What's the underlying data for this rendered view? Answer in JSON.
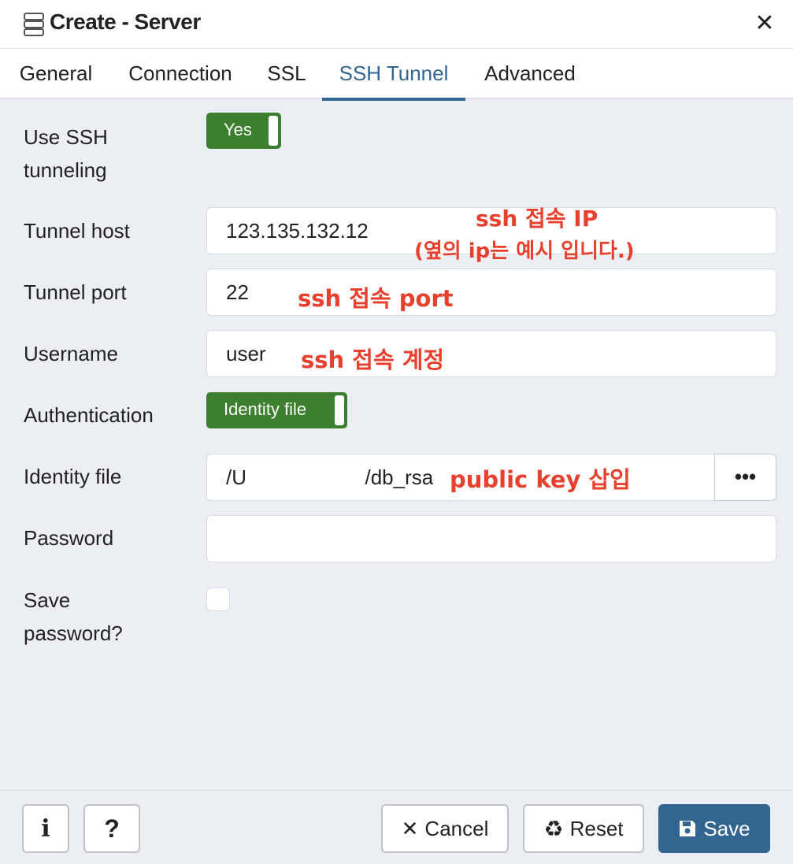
{
  "dialog": {
    "title": "Create - Server",
    "close_icon": "close-icon",
    "title_icon": "server-icon"
  },
  "tabs": [
    {
      "label": "General",
      "active": false
    },
    {
      "label": "Connection",
      "active": false
    },
    {
      "label": "SSL",
      "active": false
    },
    {
      "label": "SSH Tunnel",
      "active": true
    },
    {
      "label": "Advanced",
      "active": false
    }
  ],
  "form": {
    "use_ssh": {
      "label_line1": "Use SSH",
      "label_line2": "tunneling",
      "value": "Yes"
    },
    "tunnel_host": {
      "label": "Tunnel host",
      "value": "123.135.132.12"
    },
    "tunnel_port": {
      "label": "Tunnel port",
      "value": "22"
    },
    "username": {
      "label": "Username",
      "value": "user"
    },
    "authentication": {
      "label": "Authentication",
      "value": "Identity file"
    },
    "identity_file": {
      "label": "Identity file",
      "value_prefix": "/U",
      "value_suffix": "/db_rsa",
      "browse_label": "•••"
    },
    "password": {
      "label": "Password",
      "value": ""
    },
    "save_password": {
      "label_line1": "Save",
      "label_line2": "password?",
      "checked": false
    }
  },
  "annotations": {
    "host_line1": "ssh 접속 IP",
    "host_line2": "(옆의 ip는 예시 입니다.)",
    "port": "ssh 접속 port",
    "username": "ssh 접속 계정",
    "identity": "public key 삽입"
  },
  "footer": {
    "info_label": "i",
    "help_label": "?",
    "cancel_label": "Cancel",
    "reset_label": "Reset",
    "save_label": "Save"
  },
  "colors": {
    "accent": "#326690",
    "toggle_on": "#3c7f2e",
    "annotation": "#e8402e"
  }
}
